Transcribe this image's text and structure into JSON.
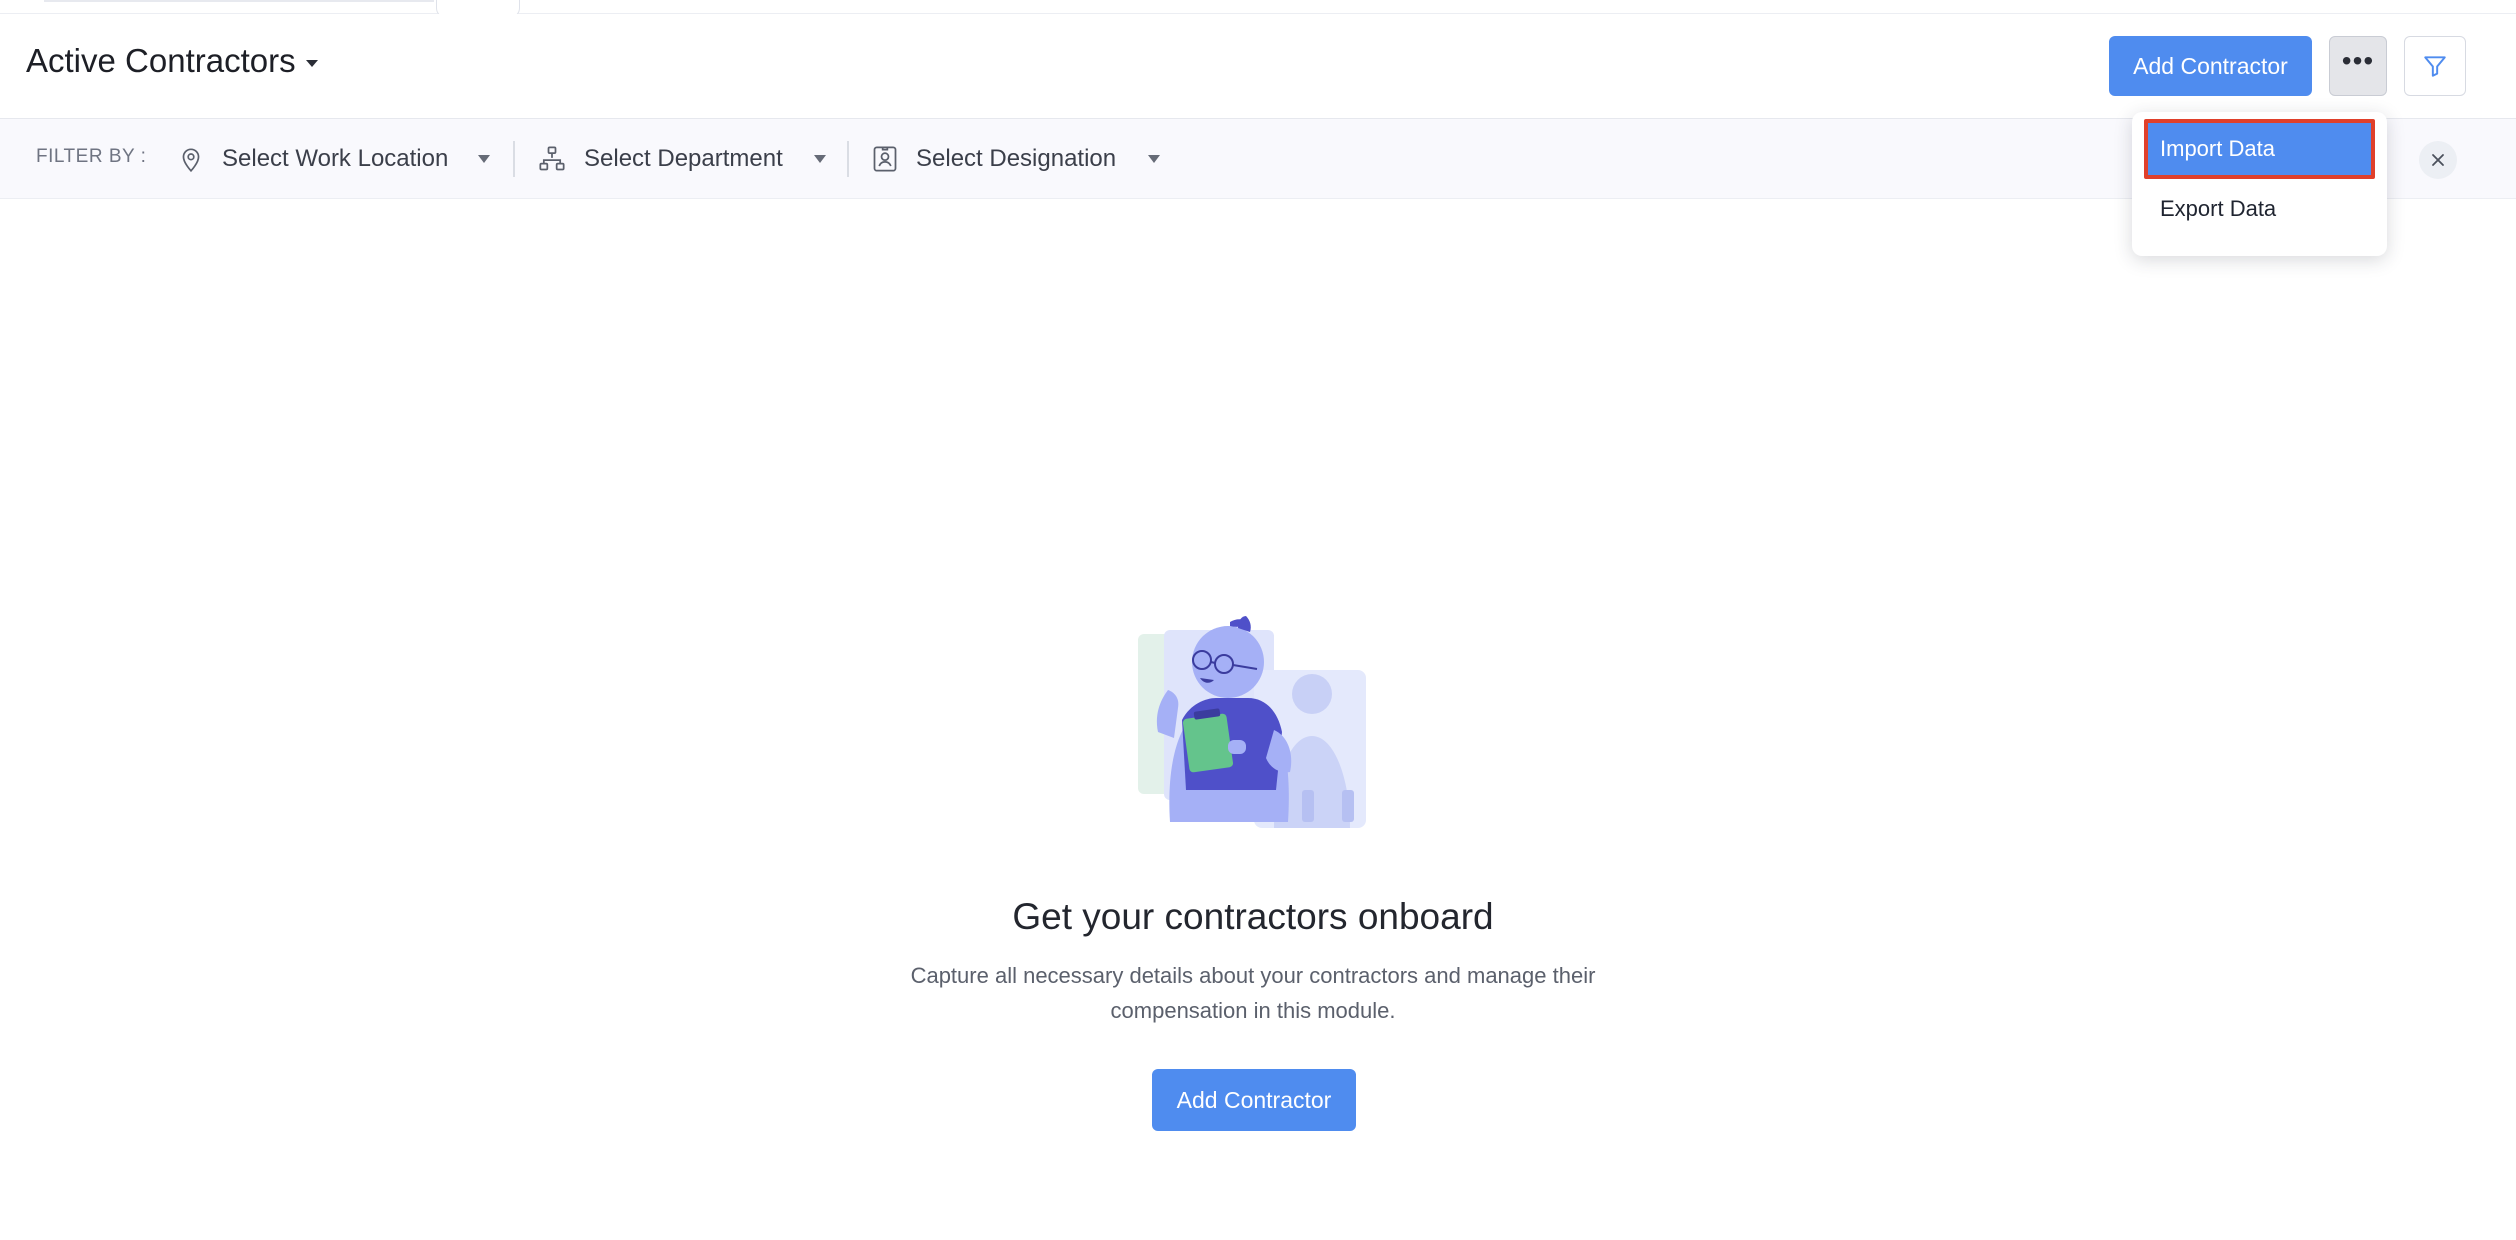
{
  "header": {
    "title": "Active Contractors",
    "add_button_label": "Add Contractor",
    "more_label": "•••"
  },
  "filter_bar": {
    "label": "FILTER BY :",
    "work_location_placeholder": "Select Work Location",
    "department_placeholder": "Select Department",
    "designation_placeholder": "Select Designation"
  },
  "dropdown": {
    "items": [
      {
        "label": "Import Data",
        "highlighted": true
      },
      {
        "label": "Export Data",
        "highlighted": false
      }
    ]
  },
  "empty_state": {
    "title": "Get your contractors onboard",
    "description": "Capture all necessary details about your contractors and manage their compensation in this module.",
    "button_label": "Add Contractor"
  },
  "colors": {
    "primary": "#4f8cef",
    "highlight_border": "#e0402b",
    "filter_bar_bg": "#f9f9fd"
  },
  "icons": [
    "caret-down-icon",
    "more-dots-icon",
    "filter-funnel-icon",
    "map-pin-icon",
    "org-tree-icon",
    "id-badge-icon",
    "dropdown-triangle-icon",
    "close-icon",
    "contractor-illustration"
  ]
}
